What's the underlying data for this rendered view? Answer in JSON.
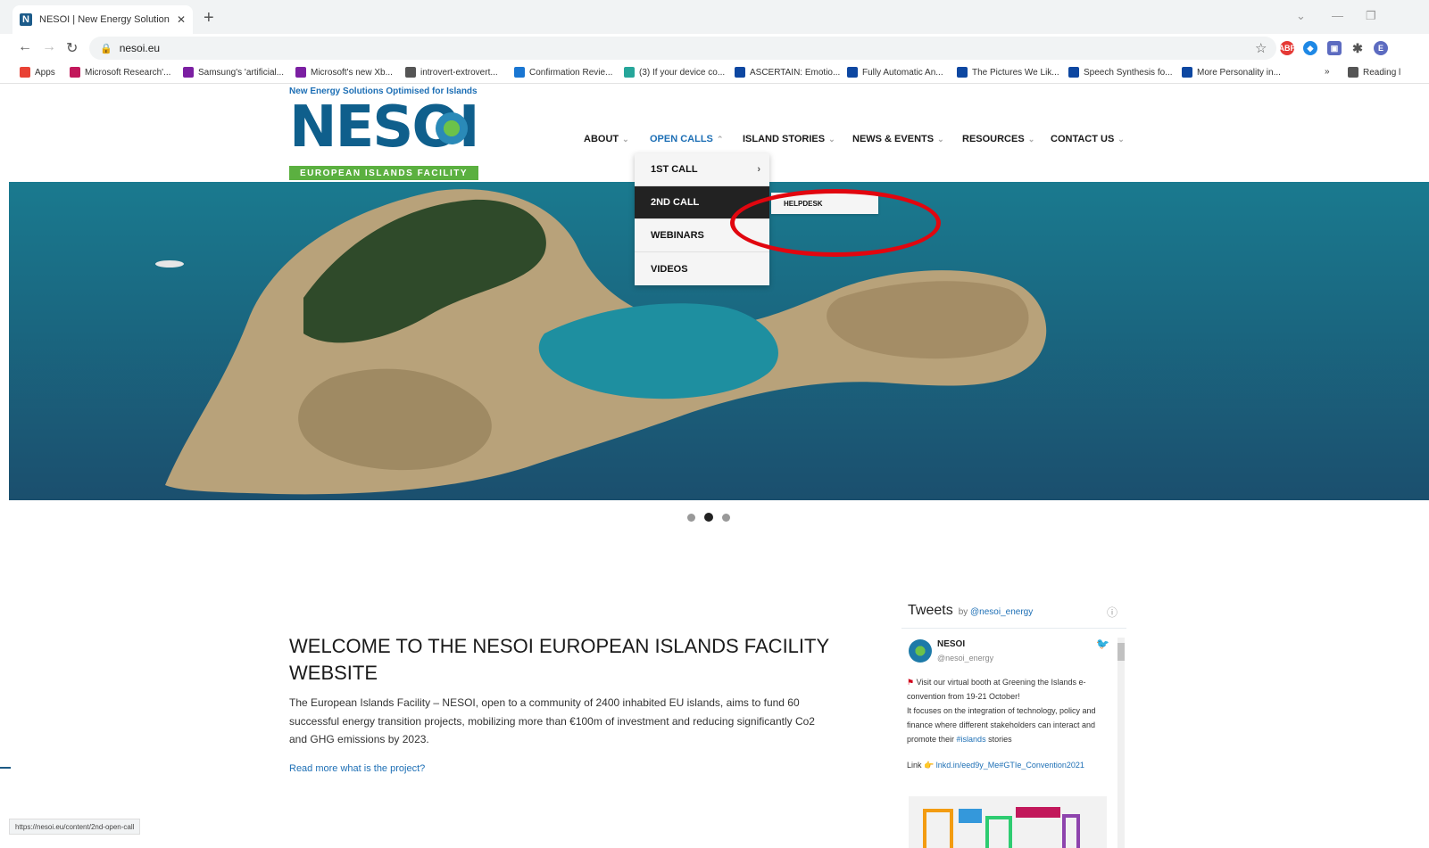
{
  "browser": {
    "tab_title": "NESOI | New Energy Solutions O",
    "tab_favicon": "N",
    "url": "nesoi.eu",
    "status_url": "https://nesoi.eu/content/2nd-open-call"
  },
  "bookmarks": [
    {
      "label": "Apps",
      "icon": "apps-grid-icon",
      "color": "#e94235"
    },
    {
      "label": "Microsoft Research'...",
      "icon": "VB",
      "color": "#c2185b"
    },
    {
      "label": "Samsung's 'artificial...",
      "icon": "V",
      "color": "#7b1fa2"
    },
    {
      "label": "Microsoft's new Xb...",
      "icon": "V",
      "color": "#7b1fa2"
    },
    {
      "label": "introvert-extrovert...",
      "icon": "img",
      "color": "#555555"
    },
    {
      "label": "Confirmation Revie...",
      "icon": "shield",
      "color": "#1976d2"
    },
    {
      "label": "(3) If your device co...",
      "icon": "q",
      "color": "#26a69a"
    },
    {
      "label": "ASCERTAIN: Emotio...",
      "icon": "ieee",
      "color": "#0d47a1"
    },
    {
      "label": "Fully Automatic An...",
      "icon": "ieee",
      "color": "#0d47a1"
    },
    {
      "label": "The Pictures We Lik...",
      "icon": "ieee",
      "color": "#0d47a1"
    },
    {
      "label": "Speech Synthesis fo...",
      "icon": "ieee",
      "color": "#0d47a1"
    },
    {
      "label": "More Personality in...",
      "icon": "ieee",
      "color": "#0d47a1"
    },
    {
      "label": "»",
      "icon": "",
      "color": ""
    },
    {
      "label": "Reading l",
      "icon": "reading-list-icon",
      "color": "#555555"
    }
  ],
  "site": {
    "tagline": "New Energy Solutions Optimised for Islands",
    "logo_text": "NESOI",
    "logo_bar": "EUROPEAN ISLANDS FACILITY",
    "brand_blue": "#0f5f8c",
    "brand_green": "#5bb040"
  },
  "nav": {
    "items": [
      {
        "label": "ABOUT",
        "active": false
      },
      {
        "label": "OPEN CALLS",
        "active": true
      },
      {
        "label": "ISLAND STORIES",
        "active": false
      },
      {
        "label": "NEWS & EVENTS",
        "active": false
      },
      {
        "label": "RESOURCES",
        "active": false
      },
      {
        "label": "CONTACT US",
        "active": false
      }
    ]
  },
  "dropdown": {
    "items": [
      {
        "label": "1ST CALL",
        "has_submenu": true,
        "selected": false
      },
      {
        "label": "2ND CALL",
        "has_submenu": false,
        "selected": true
      },
      {
        "label": "WEBINARS",
        "has_submenu": false,
        "selected": false
      },
      {
        "label": "VIDEOS",
        "has_submenu": false,
        "selected": false
      }
    ],
    "submenu": {
      "label": "HELPDESK"
    }
  },
  "annotation_color": "#e1060f",
  "carousel": {
    "count": 3,
    "active_index": 1
  },
  "welcome": {
    "title": "WELCOME TO THE NESOI EUROPEAN ISLANDS FACILITY WEBSITE",
    "body": "The European Islands Facility – NESOI, open to a community of 2400 inhabited EU islands, aims to fund 60 successful energy transition projects, mobilizing more than €100m of investment and reducing significantly Co2 and GHG emissions  by 2023.",
    "read_more": "Read more what is the project?"
  },
  "tweets": {
    "title": "Tweets",
    "by": "by",
    "handle_link": "@nesoi_energy",
    "author_name": "NESOI",
    "author_handle": "@nesoi_energy",
    "text_line1": "Visit our virtual booth at Greening the Islands e-convention from 19-21 October!",
    "text_line2": "It focuses on the integration of technology, policy and finance where different stakeholders can interact and promote their",
    "hashtag": "#islands",
    "text_tail": "stories",
    "link_label": "Link",
    "link_url": "lnkd.in/eed9y_Me#GTIe_Convention2021"
  }
}
